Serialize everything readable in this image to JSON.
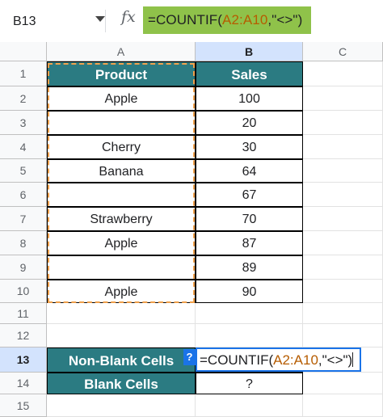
{
  "name_box": "B13",
  "formula_bar": {
    "prefix": "=COUNTIF(",
    "range": "A2:A10",
    "suffix": ",\"<>\")"
  },
  "columns": [
    "A",
    "B",
    "C"
  ],
  "rows": [
    "1",
    "2",
    "3",
    "4",
    "5",
    "6",
    "7",
    "8",
    "9",
    "10",
    "11",
    "12",
    "13",
    "14",
    "15"
  ],
  "table": {
    "headers": [
      "Product",
      "Sales"
    ],
    "products": [
      "Apple",
      "",
      "Cherry",
      "Banana",
      "",
      "Strawberry",
      "Apple",
      "",
      "Apple"
    ],
    "sales": [
      "100",
      "20",
      "30",
      "64",
      "67",
      "70",
      "87",
      "89",
      "90"
    ]
  },
  "summary": {
    "non_blank_label": "Non-Blank Cells",
    "blank_label": "Blank Cells",
    "blank_value": "?"
  },
  "editing": {
    "prefix": "=COUNTIF(",
    "range": "A2:A10",
    "suffix": ",\"<>\")",
    "help_badge": "?"
  },
  "colors": {
    "header_fill": "#2b7b82",
    "formula_highlight": "#8fc24a",
    "range_dash": "#f0a04b",
    "active_border": "#1a73e8"
  }
}
